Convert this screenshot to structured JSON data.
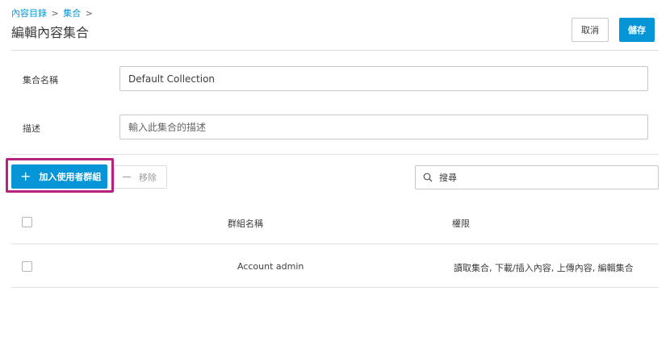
{
  "breadcrumb": {
    "item1": "內容目錄",
    "separator": ">",
    "item2": "集合"
  },
  "page_title": "編輯內容集合",
  "header_buttons": {
    "cancel": "取消",
    "save": "儲存"
  },
  "form": {
    "name_label": "集合名稱",
    "name_value": "Default Collection",
    "description_label": "描述",
    "description_placeholder": "輸入此集合的描述"
  },
  "toolbar": {
    "add_group": "加入使用者群組",
    "remove": "移除",
    "search_placeholder": "搜尋"
  },
  "table": {
    "headers": [
      "群組名稱",
      "權限"
    ],
    "rows": [
      {
        "group_name": "Account admin",
        "permissions": "讀取集合, 下載/插入內容, 上傳內容, 編輯集合"
      }
    ]
  },
  "colors": {
    "accent": "#0696d7",
    "highlight": "#b5237e"
  },
  "icons": {
    "add": "plus-icon",
    "remove": "minus-icon",
    "search": "search-icon"
  }
}
